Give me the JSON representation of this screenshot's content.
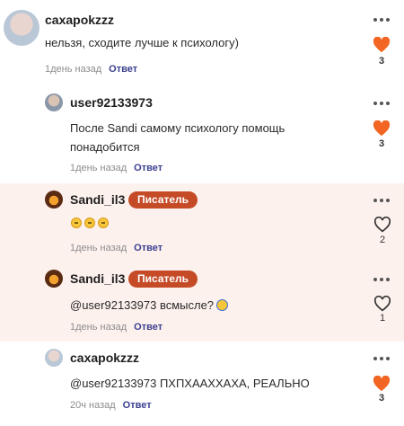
{
  "comments": [
    {
      "username": "caxapokzzz",
      "text": "нельзя, сходите лучше к психологу)",
      "time": "1день назад",
      "reply_label": "Ответ",
      "likes": "3",
      "liked": true,
      "avatar_icon": "user-photo-avatar"
    },
    {
      "username": "user92133973",
      "text": "После Sandi самому психологу помощь понадобится",
      "time": "1день назад",
      "reply_label": "Ответ",
      "likes": "3",
      "liked": true,
      "avatar_icon": "user-photo-avatar"
    },
    {
      "username": "Sandi_il3",
      "badge": "Писатель",
      "text": "",
      "emojis": [
        "pleading-face",
        "pleading-face",
        "pleading-face"
      ],
      "time": "1день назад",
      "reply_label": "Ответ",
      "likes": "2",
      "liked": false,
      "avatar_icon": "author-avatar"
    },
    {
      "username": "Sandi_il3",
      "badge": "Писатель",
      "text": "@user92133973 всмысле?",
      "emoji": "screaming-face",
      "time": "1день назад",
      "reply_label": "Ответ",
      "likes": "1",
      "liked": false,
      "avatar_icon": "author-avatar"
    },
    {
      "username": "caxapokzzz",
      "text": "@user92133973 ПХПХААХХАХА, РЕАЛЬНО",
      "time": "20ч назад",
      "reply_label": "Ответ",
      "likes": "3",
      "liked": true,
      "avatar_icon": "user-photo-avatar"
    }
  ],
  "colors": {
    "heart_filled": "#f26522",
    "badge": "#c54a26",
    "reply_link": "#3a3f8f",
    "highlight_bg": "#fdf1ee"
  }
}
